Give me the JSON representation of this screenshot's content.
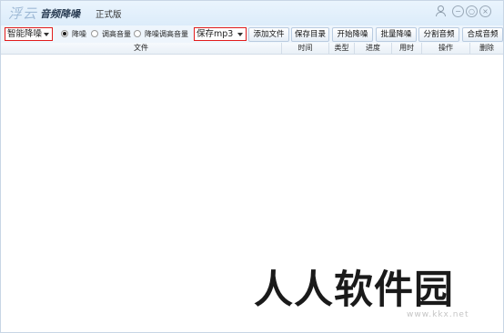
{
  "titlebar": {
    "logo_text": "浮云",
    "app_name": "音频降噪",
    "edition": "正式版",
    "icons": [
      "user-icon",
      "minimize-icon",
      "restore-icon",
      "close-icon"
    ]
  },
  "toolbar": {
    "mode_select": "智能降噪",
    "radios": [
      {
        "label": "降噪",
        "checked": true
      },
      {
        "label": "调高音量",
        "checked": false
      },
      {
        "label": "降噪调高音量",
        "checked": false
      }
    ],
    "format_select": "保存mp3",
    "buttons": {
      "add_file": "添加文件",
      "save_dir": "保存目录",
      "start": "开始降噪",
      "batch": "批量降噪",
      "split": "分割音频",
      "merge": "合成音频"
    },
    "highlight_color": "#e21c1c"
  },
  "table": {
    "columns": [
      "文件",
      "时间",
      "类型",
      "进度",
      "用时",
      "操作",
      "删除"
    ],
    "rows": []
  },
  "watermark": {
    "text": "人人软件园",
    "url": "www.kkx.net"
  }
}
